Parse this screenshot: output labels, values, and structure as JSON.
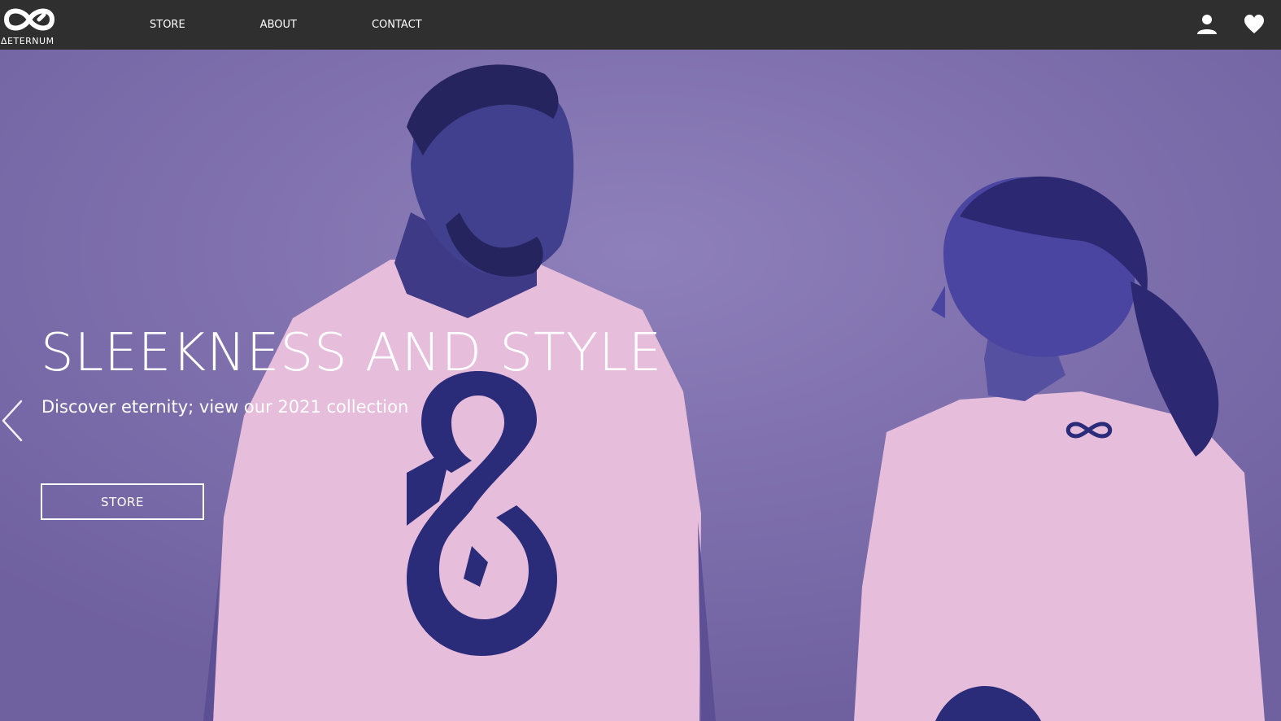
{
  "nav": {
    "logo_text": "ΔETERNUM",
    "links": [
      {
        "label": "STORE"
      },
      {
        "label": "ABOUT"
      },
      {
        "label": "CONTACT"
      }
    ],
    "icons": [
      "user-icon",
      "heart-icon"
    ]
  },
  "hero": {
    "title": "SLEEKNESS AND STYLE",
    "subtitle": "Discover eternity; view our 2021 collection",
    "button_label": "STORE",
    "prev_icon": "chevron-left-icon"
  },
  "colors": {
    "navbar": "#2f2f2f",
    "hero_background": "#8a7cb6",
    "shirt": "#e7bddc",
    "logo_print": "#2a2c7a",
    "text": "#ffffff"
  }
}
